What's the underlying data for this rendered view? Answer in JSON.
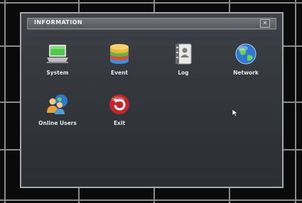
{
  "window": {
    "title": "INFORMATION",
    "close_label": "✕"
  },
  "menu": {
    "items": [
      {
        "label": "System",
        "icon": "laptop-icon"
      },
      {
        "label": "Event",
        "icon": "event-stack-icon"
      },
      {
        "label": "Log",
        "icon": "log-book-icon"
      },
      {
        "label": "Network",
        "icon": "globe-icon"
      },
      {
        "label": "Online Users",
        "icon": "users-globe-icon"
      },
      {
        "label": "Exit",
        "icon": "exit-icon"
      }
    ]
  },
  "colors": {
    "window_bg": "#34373c",
    "title_bar": "#5f6368",
    "exit_red": "#c0262b",
    "globe_blue": "#2e78d0"
  }
}
